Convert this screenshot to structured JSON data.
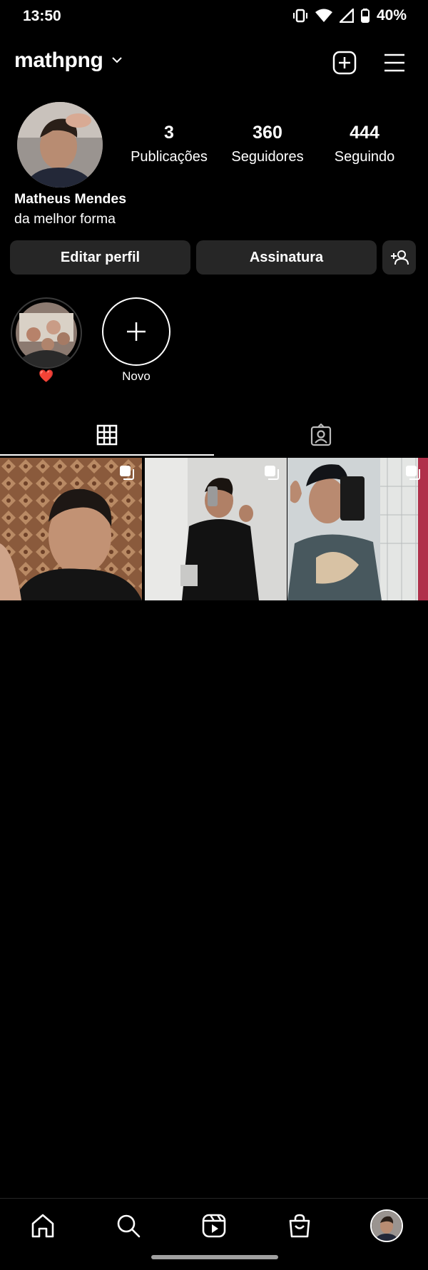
{
  "status": {
    "time": "13:50",
    "battery": "40%"
  },
  "profile": {
    "username": "mathpng",
    "full_name": "Matheus Mendes",
    "bio": "da melhor forma",
    "stats": [
      {
        "value": "3",
        "label": "Publicações"
      },
      {
        "value": "360",
        "label": "Seguidores"
      },
      {
        "value": "444",
        "label": "Seguindo"
      }
    ]
  },
  "actions": {
    "edit": "Editar perfil",
    "subscribe": "Assinatura"
  },
  "highlights": [
    {
      "label": "❤️"
    },
    {
      "label": "Novo"
    }
  ],
  "tabs": [
    "grid-icon",
    "tagged-icon"
  ],
  "nav": [
    "home-icon",
    "search-icon",
    "reels-icon",
    "shop-icon",
    "profile-avatar"
  ]
}
